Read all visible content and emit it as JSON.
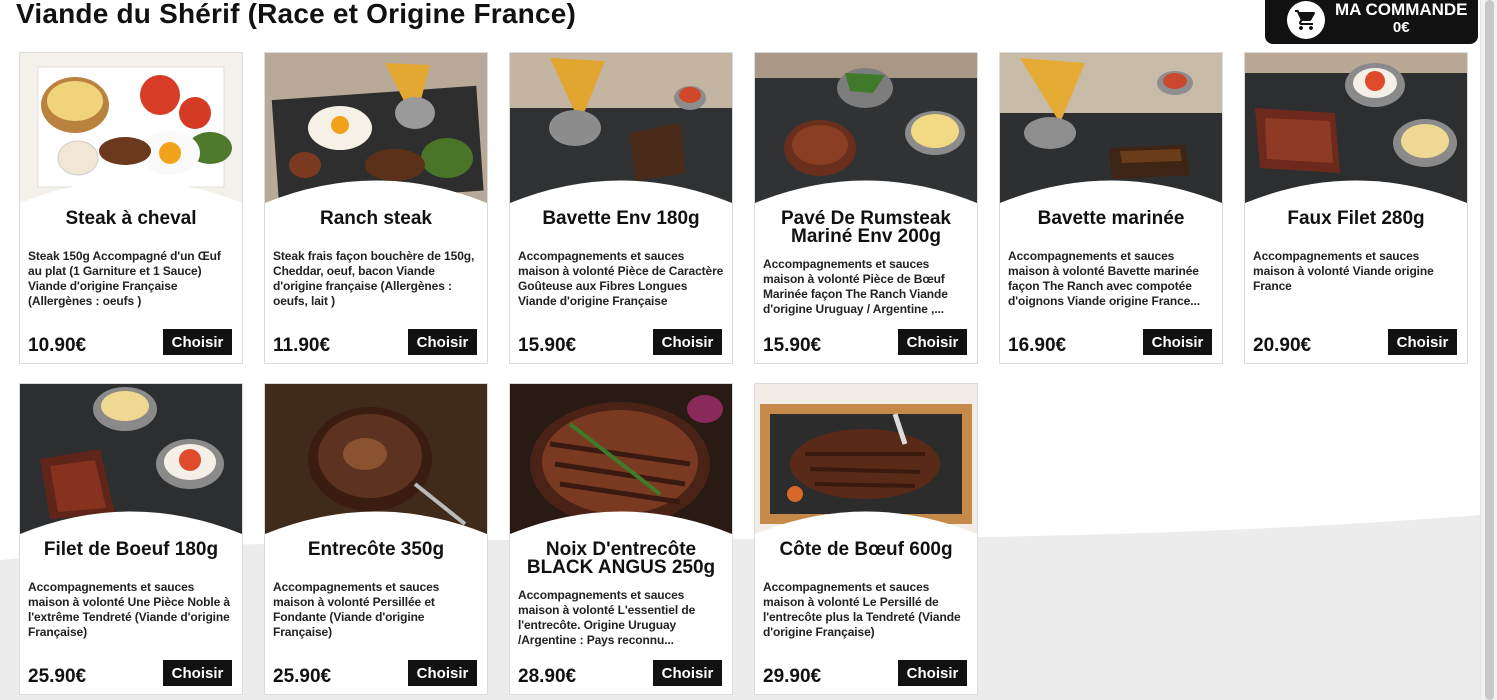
{
  "page": {
    "title": "Viande du Shérif (Race et Origine France)"
  },
  "cart": {
    "title": "MA COMMANDE",
    "amount": "0€",
    "icon": "shopping-cart-icon"
  },
  "colors": {
    "accent": "#111111",
    "card_border": "#dcdcdc",
    "background_wave": "#ededed"
  },
  "products": [
    {
      "name": "Steak à cheval",
      "description": "Steak 150g Accompagné d'un Œuf au plat (1 Garniture et 1 Sauce) Viande d'origine Française (Allergènes : oeufs )",
      "price": "10.90€",
      "button": "Choisir"
    },
    {
      "name": "Ranch steak",
      "description": "Steak frais façon bouchère de 150g, Cheddar, oeuf, bacon Viande d'origine française (Allergènes : oeufs, lait )",
      "price": "11.90€",
      "button": "Choisir"
    },
    {
      "name": "Bavette Env 180g",
      "description": "Accompagnements et sauces maison à volonté Pièce de Caractère Goûteuse aux Fibres Longues Viande d'origine Française",
      "price": "15.90€",
      "button": "Choisir"
    },
    {
      "name": "Pavé De Rumsteak Mariné Env 200g",
      "description": "Accompagnements et sauces maison à volonté Pièce de Bœuf Marinée façon The Ranch Viande d'origine Uruguay / Argentine ,...",
      "price": "15.90€",
      "button": "Choisir"
    },
    {
      "name": "Bavette marinée",
      "description": "Accompagnements et sauces maison à volonté Bavette marinée façon The Ranch avec compotée d'oignons Viande origine France...",
      "price": "16.90€",
      "button": "Choisir"
    },
    {
      "name": "Faux Filet 280g",
      "description": "Accompagnements et sauces maison à volonté Viande origine France",
      "price": "20.90€",
      "button": "Choisir"
    },
    {
      "name": "Filet de Boeuf 180g",
      "description": "Accompagnements et sauces maison à volonté Une Pièce Noble à l'extrême Tendreté (Viande d'origine Française)",
      "price": "25.90€",
      "button": "Choisir"
    },
    {
      "name": "Entrecôte 350g",
      "description": "Accompagnements et sauces maison à volonté Persillée et Fondante (Viande d'origine Française)",
      "price": "25.90€",
      "button": "Choisir"
    },
    {
      "name": "Noix D'entrecôte BLACK ANGUS 250g",
      "description": "Accompagnements et sauces maison à volonté L'essentiel de l'entrecôte. Origine Uruguay /Argentine : Pays reconnu...",
      "price": "28.90€",
      "button": "Choisir"
    },
    {
      "name": "Côte de Bœuf 600g",
      "description": "Accompagnements et sauces maison à volonté Le Persillé de l'entrecôte plus la Tendreté (Viande d'origine Française)",
      "price": "29.90€",
      "button": "Choisir"
    }
  ]
}
